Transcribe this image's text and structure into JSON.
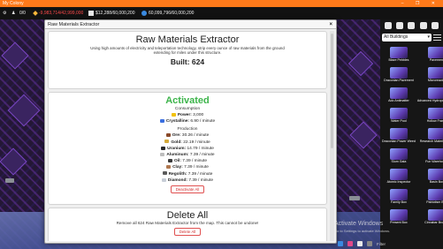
{
  "window": {
    "title": "My Colony",
    "controls": "–  ❐  ✕"
  },
  "topbar": {
    "count_a": "0/0",
    "ore_value": "-9,983,714/42,999,000",
    "money_value": "$12,288/60,000,200",
    "research_value": "60,099,796/60,000,200"
  },
  "side": {
    "select_value": "All Buildings",
    "buildings": [
      "Blaze Pebbles",
      "Pavement",
      "Draconian Pavement",
      "Microreactor",
      "Ado Antimatter",
      "Advanced Hydroponics Lab",
      "Water Pool",
      "Hollow Frame",
      "Draconian Power Weed",
      "Research Materials Site",
      "Slum Gala",
      "Fun Warehouse",
      "Atomic Inspector",
      "Basin Box",
      "Family Box",
      "Patriotism Box",
      "Present Box",
      "Cinnabar Brother"
    ]
  },
  "modal": {
    "header": "Raw Materials Extractor",
    "close": "×",
    "title": "Raw Materials Extractor",
    "description": "Using high amounts of electricity and teleportation technology, strip every ounce of raw materials from the ground extending for miles under this structure.",
    "built_label": "Built: 624",
    "status": "Activated",
    "consumption_label": "Consumption",
    "consumption": [
      {
        "name": "Power:",
        "value": "3,000",
        "color": "#f2c20a"
      },
      {
        "name": "Crystalline:",
        "value": "6.90 / minute",
        "color": "#3a6fe0"
      }
    ],
    "production_label": "Production",
    "production": [
      {
        "name": "Ore:",
        "value": "30.26 / minute",
        "color": "#8a4a2a"
      },
      {
        "name": "Gold:",
        "value": "22.19 / minute",
        "color": "#d4aa3a"
      },
      {
        "name": "Uranium:",
        "value": "14.79 / minute",
        "color": "#2a2a2a"
      },
      {
        "name": "Aluminum:",
        "value": "7.39 / minute",
        "color": "#bdbdbd"
      },
      {
        "name": "Oil:",
        "value": "7.39 / minute",
        "color": "#3a3a3a"
      },
      {
        "name": "Clay:",
        "value": "7.39 / minute",
        "color": "#b07850"
      },
      {
        "name": "Regolith:",
        "value": "7.39 / minute",
        "color": "#5a5a5a"
      },
      {
        "name": "Diamond:",
        "value": "7.39 / minute",
        "color": "#c7cdd6"
      }
    ],
    "deactivate_label": "Deactivate All",
    "delete_title": "Delete All",
    "delete_warning": "Remove all 624 Raw Materials Extractor from the map. This cannot be undone!",
    "delete_button": "Delete All"
  },
  "overlay": {
    "activate_title": "Activate Windows",
    "activate_sub": "Go to Settings to activate Windows.",
    "filter_label": "Filter"
  },
  "colors": {
    "accent": "#ff7a1a",
    "activated": "#3cb44a",
    "danger": "#d02a2a"
  }
}
